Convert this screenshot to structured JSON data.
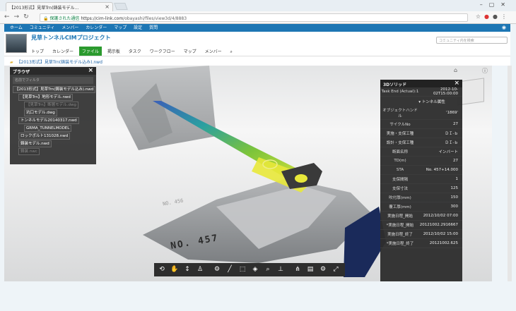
{
  "browser": {
    "tab_title": "【2013形式】見草Trn(鋳装モデル…",
    "url_secure": "保護された通信",
    "url_host": "https://cim-link.com",
    "url_path": "/obayashi/files/view3d/4/8883"
  },
  "topnav": {
    "items": [
      "ホーム",
      "コミュニティ",
      "メンバー",
      "カレンダー",
      "マップ",
      "設定",
      "質問"
    ]
  },
  "header": {
    "project_title": "見草トンネルCIMプロジェクト",
    "search_placeholder": "コミュニティ内を検索",
    "tabs": [
      "トップ",
      "カレンダー",
      "ファイル",
      "掲示板",
      "タスク",
      "ワークフロー",
      "マップ",
      "メンバー"
    ],
    "active_tab": "ファイル"
  },
  "breadcrumb": "【2013形式】見草Trn(鋳装モデル込み).nwd",
  "browser_panel": {
    "title": "ブラウザ",
    "filter_placeholder": "名前でフィルタ",
    "nodes": [
      {
        "label": "【2013形式】見草Trn(鋳装モデル込み).nwd",
        "indent": 0,
        "dim": false
      },
      {
        "label": "【見草Trn】地形モデル.nwd",
        "indent": 1,
        "dim": false
      },
      {
        "label": "【見草Trn】断層モデル.dwg",
        "indent": 2,
        "dim": true
      },
      {
        "label": "坑口モデル.dwg",
        "indent": 2,
        "dim": false
      },
      {
        "label": "トンネルモデル20140317.nwd",
        "indent": 1,
        "dim": false
      },
      {
        "label": "GRMA_TUNNELMODEL",
        "indent": 2,
        "dim": false
      },
      {
        "label": "ロックボルト131028.nwd",
        "indent": 1,
        "dim": false
      },
      {
        "label": "鋳装モデル.nwd",
        "indent": 1,
        "dim": false
      },
      {
        "label": "鋳装.nwc",
        "indent": 1,
        "dim": true
      }
    ]
  },
  "props_panel": {
    "title": "3Dソリッド",
    "rows_top": [
      {
        "k": "Task End (Actual):1",
        "v": "2012-10-02T15:00:00"
      }
    ],
    "section": "トンネル属性",
    "rows": [
      {
        "k": "オブジェクトハンドル",
        "v": "'1869'"
      },
      {
        "k": "サイクルNo",
        "v": "27"
      },
      {
        "k": "実施・支保工種",
        "v": "ＤＩ-ｂ"
      },
      {
        "k": "設計・支保工種",
        "v": "ＤＩ-ｂ"
      },
      {
        "k": "断面名称",
        "v": "インバート"
      },
      {
        "k": "TD(m)",
        "v": "27"
      },
      {
        "k": "STA",
        "v": "No. 457+14.000"
      },
      {
        "k": "支保間隔",
        "v": "1"
      },
      {
        "k": "支保寸法",
        "v": "125"
      },
      {
        "k": "吹付厚(mm)",
        "v": "150"
      },
      {
        "k": "覆工厚(mm)",
        "v": "300"
      },
      {
        "k": "実施日程_開始",
        "v": "2012/10/02 07:00"
      },
      {
        "k": "*実施日程_開始",
        "v": "20121002.2916667"
      },
      {
        "k": "実施日程_終了",
        "v": "2012/10/02 15:00"
      },
      {
        "k": "*実施日程_終了",
        "v": "20121002.625"
      }
    ]
  },
  "scene": {
    "station_label_main": "NO. 457",
    "station_label_back": "NO. 456"
  },
  "toolbar_icons": [
    "orbit-icon",
    "pan-icon",
    "zoom-icon",
    "walk-icon",
    "settings-icon",
    "measure-icon",
    "section-icon",
    "explode-icon",
    "search-icon",
    "model-browser-icon",
    "properties-icon",
    "settings-icon",
    "fullscreen-icon"
  ],
  "colors": {
    "accent_blue": "#1d76b4",
    "active_tab_green": "#2b9a2e"
  }
}
